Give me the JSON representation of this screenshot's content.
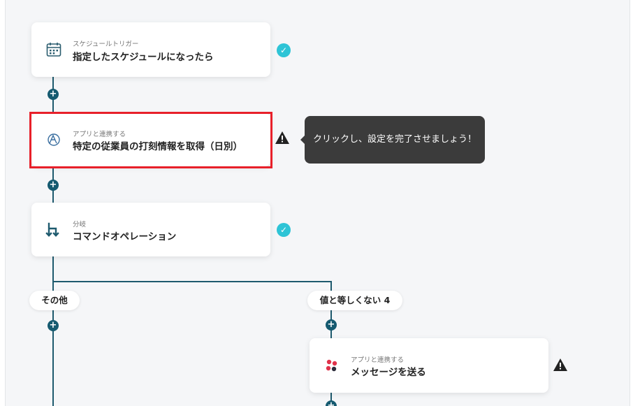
{
  "flow": {
    "step1": {
      "category": "スケジュールトリガー",
      "title": "指定したスケジュールになったら",
      "icon": "calendar-icon",
      "status": "complete"
    },
    "step2": {
      "category": "アプリと連携する",
      "title": "特定の従業員の打刻情報を取得（日別）",
      "icon": "app-logo-icon",
      "status": "warning",
      "tooltip": "クリックし、設定を完了させましょう！"
    },
    "step3": {
      "category": "分岐",
      "title": "コマンドオペレーション",
      "icon": "branch-icon",
      "status": "complete"
    },
    "branches": {
      "left_label": "その他",
      "right_label": "値と等しくない 4"
    },
    "step4": {
      "category": "アプリと連携する",
      "title": "メッセージを送る",
      "icon": "dots-logo-icon",
      "status": "warning"
    }
  },
  "colors": {
    "line": "#1e5a6e",
    "check": "#2ec4d6",
    "highlight": "#e8202a",
    "tooltip_bg": "#3b3b3b"
  }
}
